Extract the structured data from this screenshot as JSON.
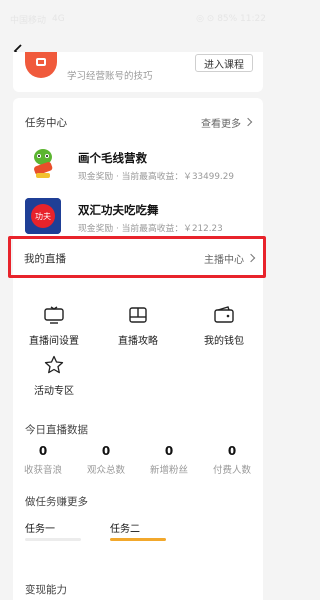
{
  "status_bar": {
    "carrier": "中国移动",
    "signal": "4G",
    "right": "◎ ⊙ 85% 11:22"
  },
  "promo": {
    "text": "学习经营账号的技巧",
    "button": "进入课程"
  },
  "task_center": {
    "title": "任务中心",
    "more": "查看更多",
    "tasks": [
      {
        "title": "画个毛线营救",
        "sub": "现金奖励 · 当前最高收益：￥33499.29"
      },
      {
        "title": "双汇功夫吃吃舞",
        "sub": "现金奖励 · 当前最高收益：￥212.23"
      }
    ]
  },
  "my_live": {
    "title": "我的直播",
    "link": "主播中心"
  },
  "grid": [
    {
      "label": "直播间设置",
      "icon": "live-settings-icon"
    },
    {
      "label": "直播攻略",
      "icon": "guide-book-icon"
    },
    {
      "label": "我的钱包",
      "icon": "wallet-icon"
    },
    {
      "label": "活动专区",
      "icon": "star-icon"
    }
  ],
  "today_stats": {
    "title": "今日直播数据",
    "items": [
      {
        "value": "0",
        "label": "收获音浪"
      },
      {
        "value": "0",
        "label": "观众总数"
      },
      {
        "value": "0",
        "label": "新增粉丝"
      },
      {
        "value": "0",
        "label": "付费人数"
      }
    ]
  },
  "earn_more": {
    "title": "做任务赚更多",
    "tasks": [
      {
        "label": "任务一",
        "progress": 0
      },
      {
        "label": "任务二",
        "progress": 1
      }
    ]
  },
  "monetize": {
    "title": "变现能力"
  },
  "colors": {
    "accent": "#f2a82c",
    "highlight": "#e8232b",
    "promo": "#f05a3c"
  }
}
